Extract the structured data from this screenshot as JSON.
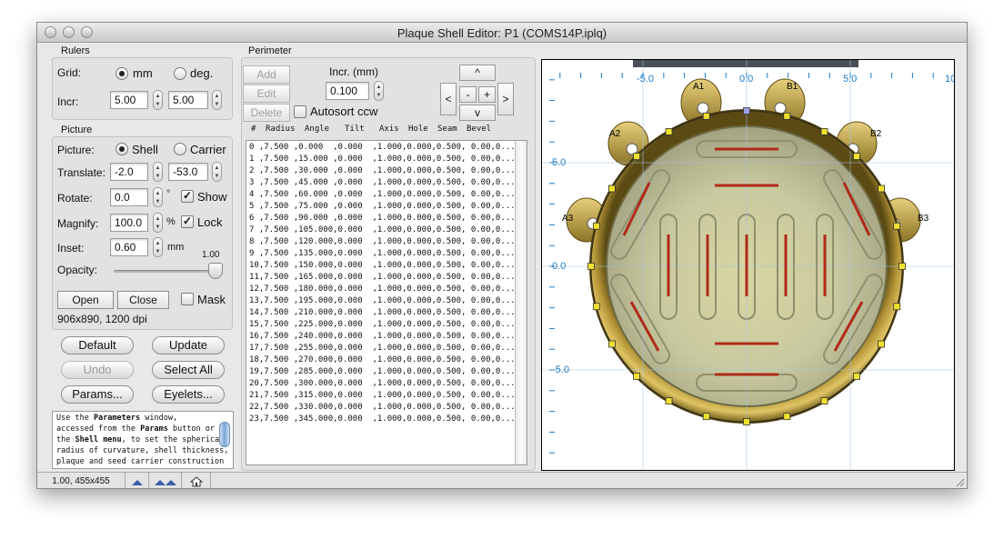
{
  "window": {
    "title": "Plaque Shell Editor: P1 (COMS14P.iplq)"
  },
  "rulers": {
    "label": "Rulers",
    "grid_label": "Grid:",
    "grid_options": [
      "mm",
      "deg."
    ],
    "grid_selected": "mm",
    "incr_label": "Incr:",
    "incr_values": [
      "5.00",
      "5.00"
    ]
  },
  "picture": {
    "label": "Picture",
    "picture_label": "Picture:",
    "picture_options": [
      "Shell",
      "Carrier"
    ],
    "picture_selected": "Shell",
    "translate_label": "Translate:",
    "translate_values": [
      "-2.0",
      "-53.0"
    ],
    "rotate_label": "Rotate:",
    "rotate_value": "0.0",
    "rotate_unit": "°",
    "show_label": "Show",
    "show_checked": true,
    "magnify_label": "Magnify:",
    "magnify_value": "100.0",
    "magnify_unit": "%",
    "lock_label": "Lock",
    "lock_checked": true,
    "inset_label": "Inset:",
    "inset_value": "0.60",
    "inset_unit": "mm",
    "opacity_label": "Opacity:",
    "opacity_value": "1.00",
    "opacity_fraction": 1.0,
    "open_label": "Open",
    "close_label": "Close",
    "mask_label": "Mask",
    "mask_checked": false,
    "image_info": "906x890, 1200 dpi"
  },
  "actions": {
    "default": "Default",
    "update": "Update",
    "undo": "Undo",
    "select_all": "Select All",
    "params": "Params...",
    "eyelets": "Eyelets..."
  },
  "help_text": {
    "line1_pre": "Use the ",
    "line1_bold": "Parameters",
    "line1_post": " window,",
    "line2_pre": "accessed from the ",
    "line2_bold": "Params",
    "line2_post": " button or",
    "line3_pre": "the ",
    "line3_bold": "Shell menu",
    "line3_post": ", to set the spherical",
    "line4": "radius of curvature, shell thickness,",
    "line5": "plaque and seed carrier construction"
  },
  "perimeter": {
    "label": "Perimeter",
    "add_label": "Add",
    "edit_label": "Edit",
    "delete_label": "Delete",
    "incr_label": "Incr. (mm)",
    "incr_value": "0.100",
    "autosort_label": "Autosort ccw",
    "autosort_checked": false,
    "nav": {
      "up": "^",
      "down": "v",
      "left": "<",
      "right": ">",
      "minus": "-",
      "plus": "+"
    },
    "columns": [
      "#",
      "Radius",
      "Angle",
      "Tilt",
      "Axis",
      "Hole",
      "Seam",
      "Bevel"
    ],
    "rows": [
      "0 ,7.500 ,0.000  ,0.000  ,1.000,0.000,0.500, 0.00,0...",
      "1 ,7.500 ,15.000 ,0.000  ,1.000,0.000,0.500, 0.00,0...",
      "2 ,7.500 ,30.000 ,0.000  ,1.000,0.000,0.500, 0.00,0...",
      "3 ,7.500 ,45.000 ,0.000  ,1.000,0.000,0.500, 0.00,0...",
      "4 ,7.500 ,60.000 ,0.000  ,1.000,0.000,0.500, 0.00,0...",
      "5 ,7.500 ,75.000 ,0.000  ,1.000,0.000,0.500, 0.00,0...",
      "6 ,7.500 ,90.000 ,0.000  ,1.000,0.000,0.500, 0.00,0...",
      "7 ,7.500 ,105.000,0.000  ,1.000,0.000,0.500, 0.00,0...",
      "8 ,7.500 ,120.000,0.000  ,1.000,0.000,0.500, 0.00,0...",
      "9 ,7.500 ,135.000,0.000  ,1.000,0.000,0.500, 0.00,0...",
      "10,7.500 ,150.000,0.000  ,1.000,0.000,0.500, 0.00,0...",
      "11,7.500 ,165.000,0.000  ,1.000,0.000,0.500, 0.00,0...",
      "12,7.500 ,180.000,0.000  ,1.000,0.000,0.500, 0.00,0...",
      "13,7.500 ,195.000,0.000  ,1.000,0.000,0.500, 0.00,0...",
      "14,7.500 ,210.000,0.000  ,1.000,0.000,0.500, 0.00,0...",
      "15,7.500 ,225.000,0.000  ,1.000,0.000,0.500, 0.00,0...",
      "16,7.500 ,240.000,0.000  ,1.000,0.000,0.500, 0.00,0...",
      "17,7.500 ,255.000,0.000  ,1.000,0.000,0.500, 0.00,0...",
      "18,7.500 ,270.000,0.000  ,1.000,0.000,0.500, 0.00,0...",
      "19,7.500 ,285.000,0.000  ,1.000,0.000,0.500, 0.00,0...",
      "20,7.500 ,300.000,0.000  ,1.000,0.000,0.500, 0.00,0...",
      "21,7.500 ,315.000,0.000  ,1.000,0.000,0.500, 0.00,0...",
      "22,7.500 ,330.000,0.000  ,1.000,0.000,0.500, 0.00,0...",
      "23,7.500 ,345.000,0.000  ,1.000,0.000,0.500, 0.00,0..."
    ]
  },
  "canvas": {
    "ruler_labels_x": [
      "-5.0",
      "0.0",
      "5.0",
      "10"
    ],
    "ruler_labels_y": [
      "5.0",
      "0.0",
      "-5.0"
    ],
    "eyelet_labels": [
      "A1",
      "B1",
      "A2",
      "B2",
      "A3",
      "B3"
    ],
    "accent_color": "#1a7bc4",
    "seed_color": "#b02a1a",
    "handle_color": "#f0e030"
  },
  "status": {
    "zoom_info": "1.00, 455x455",
    "icons": [
      "zoom-in-icon",
      "zoom-out-icon",
      "home-icon"
    ]
  }
}
